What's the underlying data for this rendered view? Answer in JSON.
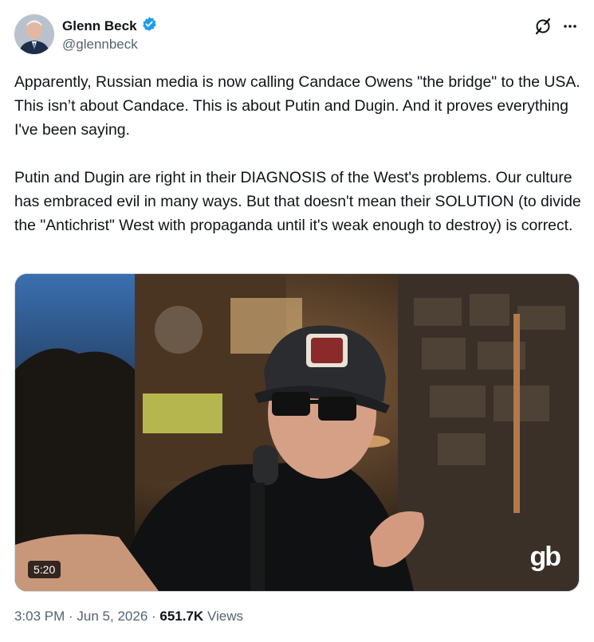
{
  "author": {
    "display_name": "Glenn Beck",
    "handle": "@glennbeck",
    "verified": true,
    "verified_color": "#1d9bf0"
  },
  "icons": {
    "grok": "grok-icon",
    "more": "more-icon",
    "verified": "verified-badge-icon"
  },
  "tweet": {
    "text": "Apparently, Russian media is now calling Candace Owens \"the bridge\" to the USA. This isn’t about Candace. This is about Putin and Dugin. And it proves everything I've been saying.\n\nPutin and Dugin are right in their DIAGNOSIS of the West's problems. Our culture has embraced evil in many ways. But that doesn't mean their SOLUTION (to divide the \"Antichrist\" West with propaganda until it's weak enough to destroy) is correct."
  },
  "media": {
    "duration": "5:20",
    "watermark": "gb"
  },
  "meta": {
    "time": "3:03 PM",
    "sep1": " · ",
    "date": "Jun 5, 2026",
    "sep2": " · ",
    "views_count": "651.7K",
    "views_label": " Views"
  }
}
